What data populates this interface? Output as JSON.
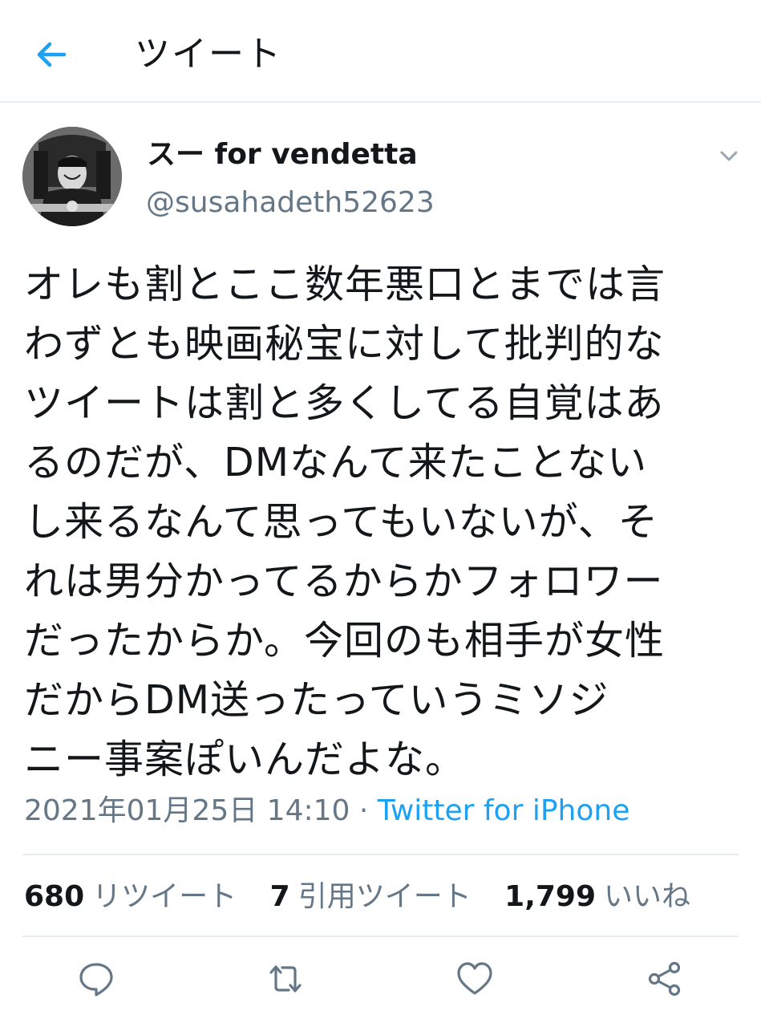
{
  "header": {
    "title": "ツイート",
    "back_icon": "arrow-left-icon"
  },
  "colors": {
    "accent": "#1da1f2",
    "text": "#14171a",
    "secondary": "#657786",
    "divider": "#e6ecf0"
  },
  "author": {
    "display_name": "スー for vendetta",
    "handle": "@susahadeth52623"
  },
  "tweet": {
    "lines": [
      "オレも割とここ数年悪口とまでは言",
      "わずとも映画秘宝に対して批判的な",
      "ツイートは割と多くしてる自覚はあ",
      "るのだが、DMなんて来たことない",
      "し来るなんて思ってもいないが、そ",
      "れは男分かってるからかフォロワー",
      "だったからか。今回のも相手が女性",
      "だからDM送ったっていうミソジ",
      "ニー事案ぽいんだよな。"
    ],
    "timestamp": "2021年01月25日 14:10",
    "separator": " · ",
    "source": "Twitter for iPhone"
  },
  "stats": {
    "retweets": {
      "count": "680",
      "label": "リツイート"
    },
    "quotes": {
      "count": "7",
      "label": "引用ツイート"
    },
    "likes": {
      "count": "1,799",
      "label": "いいね"
    }
  },
  "actions": {
    "reply_icon": "reply-icon",
    "retweet_icon": "retweet-icon",
    "like_icon": "heart-icon",
    "share_icon": "share-icon"
  }
}
